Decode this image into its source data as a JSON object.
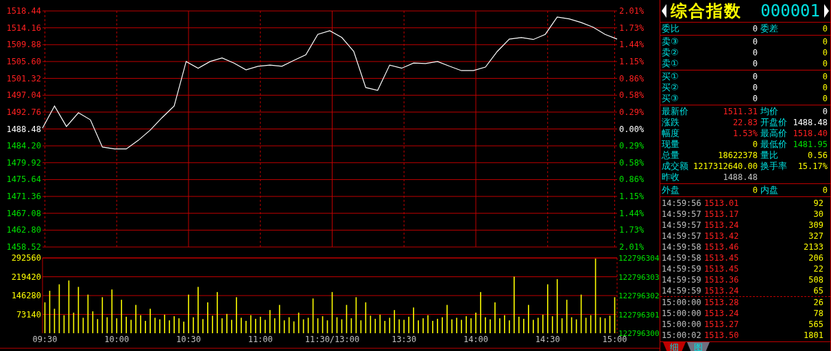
{
  "price_chart": {
    "chart_data": {
      "type": "line",
      "grid": true,
      "ylim": [
        1458.52,
        1518.44
      ],
      "yticks": [
        {
          "value": 1518.44,
          "label": "1518.44"
        },
        {
          "value": 1514.16,
          "label": "1514.16"
        },
        {
          "value": 1509.88,
          "label": "1509.88"
        },
        {
          "value": 1505.6,
          "label": "1505.60"
        },
        {
          "value": 1501.32,
          "label": "1501.32"
        },
        {
          "value": 1497.04,
          "label": "1497.04"
        },
        {
          "value": 1492.76,
          "label": "1492.76"
        },
        {
          "value": 1488.48,
          "label": "1488.48"
        },
        {
          "value": 1484.2,
          "label": "1484.20"
        },
        {
          "value": 1479.92,
          "label": "1479.92"
        },
        {
          "value": 1475.64,
          "label": "1475.64"
        },
        {
          "value": 1471.36,
          "label": "1471.36"
        },
        {
          "value": 1467.08,
          "label": "1467.08"
        },
        {
          "value": 1462.8,
          "label": "1462.80"
        },
        {
          "value": 1458.52,
          "label": "1458.52"
        }
      ],
      "series": [
        {
          "color": "#ffffff",
          "values": [
            1488.7,
            1494.3,
            1489.1,
            1492.6,
            1490.8,
            1483.9,
            1483.4,
            1483.4,
            1485.6,
            1488.2,
            1491.4,
            1494.3,
            1505.6,
            1503.9,
            1505.6,
            1506.5,
            1505.2,
            1503.5,
            1504.4,
            1504.7,
            1504.4,
            1505.9,
            1507.3,
            1512.5,
            1513.4,
            1511.7,
            1508.2,
            1499.0,
            1498.3,
            1504.7,
            1503.9,
            1505.2,
            1505.1,
            1505.6,
            1504.4,
            1503.3,
            1503.3,
            1504.2,
            1508.2,
            1511.3,
            1511.7,
            1511.2,
            1512.5,
            1516.9,
            1516.4,
            1515.5,
            1514.3,
            1512.5,
            1511.3
          ]
        }
      ]
    },
    "percent_axis": [
      {
        "label": "2.01%",
        "color": "#ff2020"
      },
      {
        "label": "1.73%",
        "color": "#ff2020"
      },
      {
        "label": "1.44%",
        "color": "#ff2020"
      },
      {
        "label": "1.15%",
        "color": "#ff2020"
      },
      {
        "label": "0.86%",
        "color": "#ff2020"
      },
      {
        "label": "0.58%",
        "color": "#ff2020"
      },
      {
        "label": "0.29%",
        "color": "#ff2020"
      },
      {
        "label": "0.00%",
        "color": "#ffffff"
      },
      {
        "label": "0.29%",
        "color": "#00e000"
      },
      {
        "label": "0.58%",
        "color": "#00e000"
      },
      {
        "label": "0.86%",
        "color": "#00e000"
      },
      {
        "label": "1.15%",
        "color": "#00e000"
      },
      {
        "label": "1.44%",
        "color": "#00e000"
      },
      {
        "label": "1.73%",
        "color": "#00e000"
      },
      {
        "label": "2.01%",
        "color": "#00e000"
      }
    ]
  },
  "volume_chart": {
    "chart_data": {
      "type": "bar",
      "grid": true,
      "ylim": [
        0,
        292560
      ],
      "yticks": [
        73140,
        146280,
        219420,
        292560
      ],
      "categories": [
        "09:30",
        null,
        null,
        null,
        null,
        null,
        null,
        null,
        null,
        null,
        null,
        null,
        null,
        null,
        null,
        "10:00",
        null,
        null,
        null,
        null,
        null,
        null,
        null,
        null,
        null,
        null,
        null,
        null,
        null,
        null,
        "10:30",
        null,
        null,
        null,
        null,
        null,
        null,
        null,
        null,
        null,
        null,
        null,
        null,
        null,
        null,
        "11:00",
        null,
        null,
        null,
        null,
        null,
        null,
        null,
        null,
        null,
        null,
        null,
        null,
        null,
        null,
        "11:30/13:00",
        null,
        null,
        null,
        null,
        null,
        null,
        null,
        null,
        null,
        null,
        null,
        null,
        null,
        null,
        "13:30",
        null,
        null,
        null,
        null,
        null,
        null,
        null,
        null,
        null,
        null,
        null,
        null,
        null,
        null,
        "14:00",
        null,
        null,
        null,
        null,
        null,
        null,
        null,
        null,
        null,
        null,
        null,
        null,
        null,
        null,
        "14:30",
        null,
        null,
        null,
        null,
        null,
        null,
        null,
        null,
        null,
        null,
        null,
        null,
        null,
        "15:00"
      ],
      "series": [
        {
          "color": "#ffff00",
          "values": [
            120000,
            165000,
            95000,
            190000,
            70000,
            205000,
            80000,
            180000,
            60000,
            150000,
            85000,
            55000,
            140000,
            62000,
            170000,
            58000,
            130000,
            64000,
            52000,
            110000,
            70000,
            48000,
            95000,
            60000,
            54000,
            72000,
            50000,
            66000,
            58000,
            45000,
            150000,
            62000,
            180000,
            55000,
            120000,
            68000,
            160000,
            58000,
            75000,
            52000,
            140000,
            60000,
            48000,
            70000,
            56000,
            64000,
            52000,
            90000,
            58000,
            110000,
            50000,
            62000,
            46000,
            80000,
            54000,
            60000,
            135000,
            58000,
            66000,
            50000,
            160000,
            62000,
            54000,
            110000,
            58000,
            140000,
            50000,
            120000,
            68000,
            56000,
            72000,
            48000,
            60000,
            90000,
            54000,
            52000,
            64000,
            100000,
            50000,
            58000,
            70000,
            48000,
            56000,
            62000,
            110000,
            54000,
            60000,
            52000,
            66000,
            58000,
            80000,
            160000,
            62000,
            54000,
            120000,
            58000,
            70000,
            50000,
            220000,
            64000,
            56000,
            110000,
            52000,
            60000,
            72000,
            190000,
            66000,
            210000,
            58000,
            130000,
            62000,
            54000,
            150000,
            60000,
            70000,
            290000,
            62000,
            58000,
            68000,
            140000
          ]
        }
      ]
    },
    "right_axis": [
      "122796304",
      "122796303",
      "122796302",
      "122796301",
      "122796300"
    ]
  },
  "header": {
    "name": "综合指数",
    "code": "000001"
  },
  "order_stats": [
    {
      "label": "委比",
      "value": "0",
      "color": "#ffffff"
    },
    {
      "label": "委差",
      "value": "0",
      "color": "#ffff00"
    }
  ],
  "asks": [
    {
      "label": "卖③",
      "value": "0",
      "color": "#ffffff"
    },
    {
      "value": "0",
      "color": "#ffff00"
    },
    {
      "label": "卖②",
      "value": "0",
      "color": "#ffffff"
    },
    {
      "value": "0",
      "color": "#ffff00"
    },
    {
      "label": "卖①",
      "value": "0",
      "color": "#ffffff"
    },
    {
      "value": "0",
      "color": "#ffff00"
    }
  ],
  "bids": [
    {
      "label": "买①",
      "value": "0",
      "color": "#ffffff"
    },
    {
      "value": "0",
      "color": "#ffff00"
    },
    {
      "label": "买②",
      "value": "0",
      "color": "#ffffff"
    },
    {
      "value": "0",
      "color": "#ffff00"
    },
    {
      "label": "买③",
      "value": "0",
      "color": "#ffffff"
    },
    {
      "value": "0",
      "color": "#ffff00"
    }
  ],
  "quote": [
    {
      "label": "最新价",
      "value": "1511.31",
      "color": "#ff2020"
    },
    {
      "label": "均价",
      "value": "0",
      "color": "#ffffff"
    },
    {
      "label": "涨跌",
      "value": "22.83",
      "color": "#ff2020"
    },
    {
      "label": "开盘价",
      "value": "1488.48",
      "color": "#ffffff"
    },
    {
      "label": "幅度",
      "value": "1.53%",
      "color": "#ff2020"
    },
    {
      "label": "最高价",
      "value": "1518.40",
      "color": "#ff2020"
    },
    {
      "label": "现量",
      "value": "0",
      "color": "#ffff00"
    },
    {
      "label": "最低价",
      "value": "1481.95",
      "color": "#00e000"
    },
    {
      "label": "总量",
      "value": "18622378",
      "color": "#ffff00"
    },
    {
      "label": "量比",
      "value": "0.56",
      "color": "#ffff00"
    },
    {
      "label": "成交额",
      "value": "1217312640.00",
      "color": "#ffff00"
    },
    {
      "label": "换手率",
      "value": "15.17%",
      "color": "#ffff00"
    },
    {
      "label": "昨收",
      "value": "1488.48",
      "color": "#c0c0c0"
    }
  ],
  "outer": [
    {
      "label": "外盘",
      "value": "0",
      "color": "#ffff00"
    },
    {
      "label": "内盘",
      "value": "0",
      "color": "#ffff00"
    }
  ],
  "tick_groups": [
    [
      {
        "time": "14:59:56",
        "price": "1513.01",
        "volume": "92"
      },
      {
        "time": "14:59:57",
        "price": "1513.17",
        "volume": "30"
      },
      {
        "time": "14:59:57",
        "price": "1513.24",
        "volume": "309"
      },
      {
        "time": "14:59:57",
        "price": "1513.42",
        "volume": "327"
      },
      {
        "time": "14:59:58",
        "price": "1513.46",
        "volume": "2133"
      },
      {
        "time": "14:59:58",
        "price": "1513.45",
        "volume": "206"
      },
      {
        "time": "14:59:59",
        "price": "1513.45",
        "volume": "22"
      },
      {
        "time": "14:59:59",
        "price": "1513.36",
        "volume": "508"
      },
      {
        "time": "14:59:59",
        "price": "1513.24",
        "volume": "65"
      }
    ],
    [
      {
        "time": "15:00:00",
        "price": "1513.28",
        "volume": "26"
      },
      {
        "time": "15:00:00",
        "price": "1513.24",
        "volume": "78"
      },
      {
        "time": "15:00:00",
        "price": "1513.27",
        "volume": "565"
      },
      {
        "time": "15:00:02",
        "price": "1513.50",
        "volume": "1801"
      }
    ]
  ],
  "bottom_tabs": [
    {
      "label": "细",
      "selected": true
    },
    {
      "label": "图",
      "selected": false
    }
  ]
}
